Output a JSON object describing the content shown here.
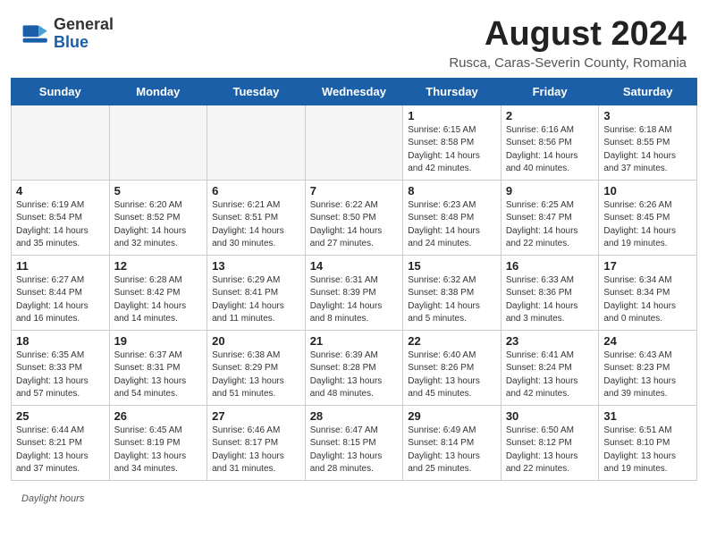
{
  "header": {
    "logo_general": "General",
    "logo_blue": "Blue",
    "month_title": "August 2024",
    "subtitle": "Rusca, Caras-Severin County, Romania"
  },
  "days_of_week": [
    "Sunday",
    "Monday",
    "Tuesday",
    "Wednesday",
    "Thursday",
    "Friday",
    "Saturday"
  ],
  "weeks": [
    [
      {
        "date": "",
        "info": ""
      },
      {
        "date": "",
        "info": ""
      },
      {
        "date": "",
        "info": ""
      },
      {
        "date": "",
        "info": ""
      },
      {
        "date": "1",
        "info": "Sunrise: 6:15 AM\nSunset: 8:58 PM\nDaylight: 14 hours and 42 minutes."
      },
      {
        "date": "2",
        "info": "Sunrise: 6:16 AM\nSunset: 8:56 PM\nDaylight: 14 hours and 40 minutes."
      },
      {
        "date": "3",
        "info": "Sunrise: 6:18 AM\nSunset: 8:55 PM\nDaylight: 14 hours and 37 minutes."
      }
    ],
    [
      {
        "date": "4",
        "info": "Sunrise: 6:19 AM\nSunset: 8:54 PM\nDaylight: 14 hours and 35 minutes."
      },
      {
        "date": "5",
        "info": "Sunrise: 6:20 AM\nSunset: 8:52 PM\nDaylight: 14 hours and 32 minutes."
      },
      {
        "date": "6",
        "info": "Sunrise: 6:21 AM\nSunset: 8:51 PM\nDaylight: 14 hours and 30 minutes."
      },
      {
        "date": "7",
        "info": "Sunrise: 6:22 AM\nSunset: 8:50 PM\nDaylight: 14 hours and 27 minutes."
      },
      {
        "date": "8",
        "info": "Sunrise: 6:23 AM\nSunset: 8:48 PM\nDaylight: 14 hours and 24 minutes."
      },
      {
        "date": "9",
        "info": "Sunrise: 6:25 AM\nSunset: 8:47 PM\nDaylight: 14 hours and 22 minutes."
      },
      {
        "date": "10",
        "info": "Sunrise: 6:26 AM\nSunset: 8:45 PM\nDaylight: 14 hours and 19 minutes."
      }
    ],
    [
      {
        "date": "11",
        "info": "Sunrise: 6:27 AM\nSunset: 8:44 PM\nDaylight: 14 hours and 16 minutes."
      },
      {
        "date": "12",
        "info": "Sunrise: 6:28 AM\nSunset: 8:42 PM\nDaylight: 14 hours and 14 minutes."
      },
      {
        "date": "13",
        "info": "Sunrise: 6:29 AM\nSunset: 8:41 PM\nDaylight: 14 hours and 11 minutes."
      },
      {
        "date": "14",
        "info": "Sunrise: 6:31 AM\nSunset: 8:39 PM\nDaylight: 14 hours and 8 minutes."
      },
      {
        "date": "15",
        "info": "Sunrise: 6:32 AM\nSunset: 8:38 PM\nDaylight: 14 hours and 5 minutes."
      },
      {
        "date": "16",
        "info": "Sunrise: 6:33 AM\nSunset: 8:36 PM\nDaylight: 14 hours and 3 minutes."
      },
      {
        "date": "17",
        "info": "Sunrise: 6:34 AM\nSunset: 8:34 PM\nDaylight: 14 hours and 0 minutes."
      }
    ],
    [
      {
        "date": "18",
        "info": "Sunrise: 6:35 AM\nSunset: 8:33 PM\nDaylight: 13 hours and 57 minutes."
      },
      {
        "date": "19",
        "info": "Sunrise: 6:37 AM\nSunset: 8:31 PM\nDaylight: 13 hours and 54 minutes."
      },
      {
        "date": "20",
        "info": "Sunrise: 6:38 AM\nSunset: 8:29 PM\nDaylight: 13 hours and 51 minutes."
      },
      {
        "date": "21",
        "info": "Sunrise: 6:39 AM\nSunset: 8:28 PM\nDaylight: 13 hours and 48 minutes."
      },
      {
        "date": "22",
        "info": "Sunrise: 6:40 AM\nSunset: 8:26 PM\nDaylight: 13 hours and 45 minutes."
      },
      {
        "date": "23",
        "info": "Sunrise: 6:41 AM\nSunset: 8:24 PM\nDaylight: 13 hours and 42 minutes."
      },
      {
        "date": "24",
        "info": "Sunrise: 6:43 AM\nSunset: 8:23 PM\nDaylight: 13 hours and 39 minutes."
      }
    ],
    [
      {
        "date": "25",
        "info": "Sunrise: 6:44 AM\nSunset: 8:21 PM\nDaylight: 13 hours and 37 minutes."
      },
      {
        "date": "26",
        "info": "Sunrise: 6:45 AM\nSunset: 8:19 PM\nDaylight: 13 hours and 34 minutes."
      },
      {
        "date": "27",
        "info": "Sunrise: 6:46 AM\nSunset: 8:17 PM\nDaylight: 13 hours and 31 minutes."
      },
      {
        "date": "28",
        "info": "Sunrise: 6:47 AM\nSunset: 8:15 PM\nDaylight: 13 hours and 28 minutes."
      },
      {
        "date": "29",
        "info": "Sunrise: 6:49 AM\nSunset: 8:14 PM\nDaylight: 13 hours and 25 minutes."
      },
      {
        "date": "30",
        "info": "Sunrise: 6:50 AM\nSunset: 8:12 PM\nDaylight: 13 hours and 22 minutes."
      },
      {
        "date": "31",
        "info": "Sunrise: 6:51 AM\nSunset: 8:10 PM\nDaylight: 13 hours and 19 minutes."
      }
    ]
  ],
  "footer": {
    "daylight_label": "Daylight hours"
  }
}
